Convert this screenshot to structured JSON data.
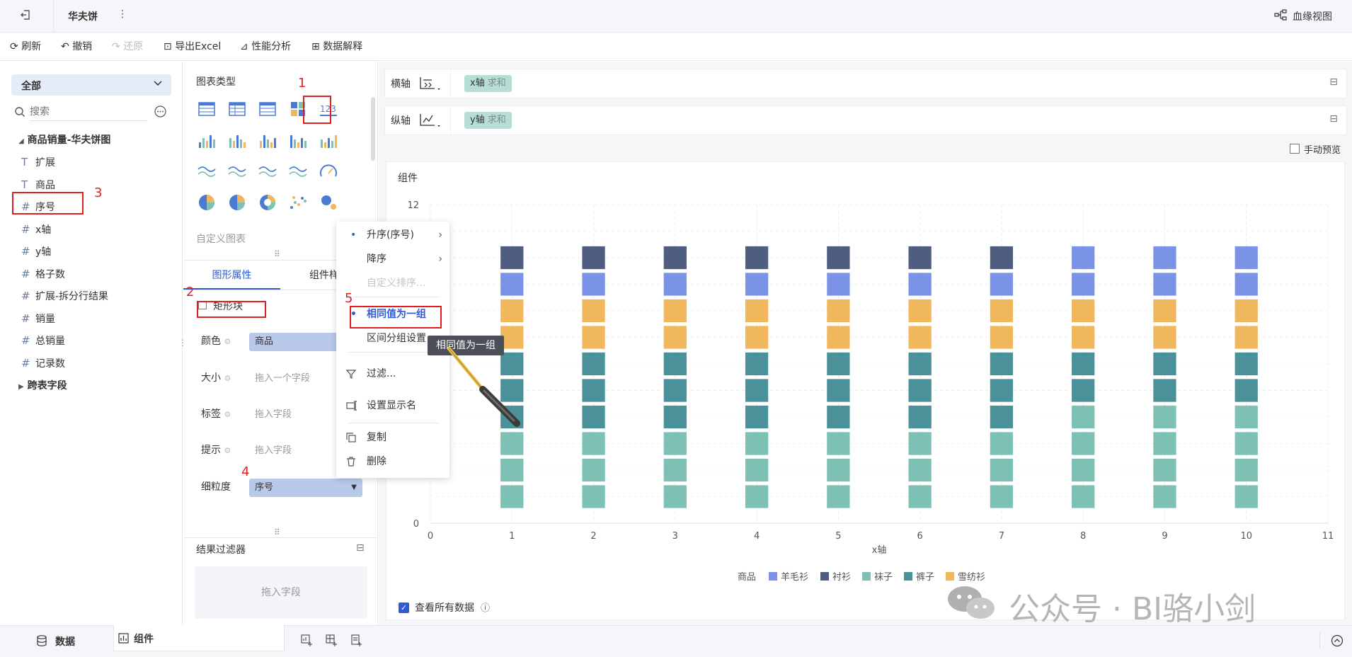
{
  "topbar": {
    "title": "华夫饼",
    "lineage": "血缘视图"
  },
  "toolbar": {
    "refresh": "刷新",
    "undo": "撤销",
    "redo": "还原",
    "export": "导出Excel",
    "perf": "性能分析",
    "explain": "数据解释"
  },
  "left": {
    "dropdown": "全部",
    "search_placeholder": "搜索",
    "table_name": "商品销量-华夫饼图",
    "fields": [
      {
        "type": "T",
        "name": "扩展"
      },
      {
        "type": "T",
        "name": "商品"
      },
      {
        "type": "#",
        "name": "序号"
      },
      {
        "type": "#",
        "name": "x轴"
      },
      {
        "type": "#",
        "name": "y轴"
      },
      {
        "type": "#",
        "name": "格子数"
      },
      {
        "type": "#",
        "name": "扩展-拆分行结果"
      },
      {
        "type": "#",
        "name": "销量"
      },
      {
        "type": "#",
        "name": "总销量"
      },
      {
        "type": "#",
        "name": "记录数"
      }
    ],
    "cross_table": "跨表字段"
  },
  "mid": {
    "chart_type_label": "图表类型",
    "custom_chart": "自定义图表",
    "tab_props": "图形属性",
    "tab_style": "组件样式",
    "shape": "矩形块",
    "color_label": "颜色",
    "color_value": "商品",
    "size_label": "大小",
    "size_placeholder": "拖入一个字段",
    "label_label": "标签",
    "label_placeholder": "拖入字段",
    "tip_label": "提示",
    "tip_placeholder": "拖入字段",
    "granularity_label": "细粒度",
    "granularity_value": "序号",
    "result_filter": "结果过滤器",
    "drop_field": "拖入字段"
  },
  "right": {
    "h_axis": "横轴",
    "v_axis": "纵轴",
    "h_pill": "x轴",
    "v_pill": "y轴",
    "agg": "求和",
    "manual_preview": "手动预览",
    "component": "组件",
    "view_all": "查看所有数据"
  },
  "menu": {
    "asc": "升序(序号)",
    "desc": "降序",
    "custom_sort": "自定义排序...",
    "same_group": "相同值为一组",
    "interval": "区间分组设置",
    "filter": "过滤...",
    "display_name": "设置显示名",
    "copy": "复制",
    "delete": "删除",
    "tooltip": "相同值为一组"
  },
  "annotations": [
    "1",
    "2",
    "3",
    "4",
    "5"
  ],
  "bottom": {
    "data_tab": "数据",
    "component_tab": "组件"
  },
  "watermark": "公众号 · BI骆小剑",
  "colors": {
    "羊毛衫": "#7b93e6",
    "衬衫": "#4e5d80",
    "袜子": "#7dc0b4",
    "裤子": "#4a9199",
    "雪纺衫": "#f0b75c",
    "accent": "#2f5ad8",
    "annotation": "#e02020"
  },
  "chart_data": {
    "type": "scatter",
    "marker": "square",
    "xlabel": "x轴",
    "ylabel": "",
    "xlim": [
      0,
      11
    ],
    "ylim": [
      0,
      12
    ],
    "x_ticks": [
      "0",
      "1",
      "2",
      "3",
      "4",
      "5",
      "6",
      "7",
      "8",
      "9",
      "10",
      "11"
    ],
    "y_ticks": [
      "0",
      "12"
    ],
    "legend_title": "商品",
    "legend_position": "bottom",
    "series": [
      {
        "name": "羊毛衫",
        "points": [
          [
            8,
            10
          ],
          [
            9,
            10
          ],
          [
            10,
            10
          ],
          [
            1,
            9
          ],
          [
            2,
            9
          ],
          [
            3,
            9
          ],
          [
            4,
            9
          ],
          [
            5,
            9
          ],
          [
            6,
            9
          ],
          [
            7,
            9
          ],
          [
            8,
            9
          ],
          [
            9,
            9
          ],
          [
            10,
            9
          ]
        ]
      },
      {
        "name": "衬衫",
        "points": [
          [
            1,
            10
          ],
          [
            2,
            10
          ],
          [
            3,
            10
          ],
          [
            4,
            10
          ],
          [
            5,
            10
          ],
          [
            6,
            10
          ],
          [
            7,
            10
          ]
        ]
      },
      {
        "name": "袜子",
        "points": [
          [
            8,
            4
          ],
          [
            9,
            4
          ],
          [
            10,
            4
          ],
          [
            1,
            3
          ],
          [
            2,
            3
          ],
          [
            3,
            3
          ],
          [
            4,
            3
          ],
          [
            5,
            3
          ],
          [
            6,
            3
          ],
          [
            7,
            3
          ],
          [
            8,
            3
          ],
          [
            9,
            3
          ],
          [
            10,
            3
          ],
          [
            1,
            2
          ],
          [
            2,
            2
          ],
          [
            3,
            2
          ],
          [
            4,
            2
          ],
          [
            5,
            2
          ],
          [
            6,
            2
          ],
          [
            7,
            2
          ],
          [
            8,
            2
          ],
          [
            9,
            2
          ],
          [
            10,
            2
          ],
          [
            1,
            1
          ],
          [
            2,
            1
          ],
          [
            3,
            1
          ],
          [
            4,
            1
          ],
          [
            5,
            1
          ],
          [
            6,
            1
          ],
          [
            7,
            1
          ],
          [
            8,
            1
          ],
          [
            9,
            1
          ],
          [
            10,
            1
          ]
        ]
      },
      {
        "name": "裤子",
        "points": [
          [
            1,
            6
          ],
          [
            2,
            6
          ],
          [
            3,
            6
          ],
          [
            4,
            6
          ],
          [
            5,
            6
          ],
          [
            6,
            6
          ],
          [
            7,
            6
          ],
          [
            8,
            6
          ],
          [
            9,
            6
          ],
          [
            10,
            6
          ],
          [
            1,
            5
          ],
          [
            2,
            5
          ],
          [
            3,
            5
          ],
          [
            4,
            5
          ],
          [
            5,
            5
          ],
          [
            6,
            5
          ],
          [
            7,
            5
          ],
          [
            8,
            5
          ],
          [
            9,
            5
          ],
          [
            10,
            5
          ],
          [
            1,
            4
          ],
          [
            2,
            4
          ],
          [
            3,
            4
          ],
          [
            4,
            4
          ],
          [
            5,
            4
          ],
          [
            6,
            4
          ],
          [
            7,
            4
          ]
        ]
      },
      {
        "name": "雪纺衫",
        "points": [
          [
            1,
            8
          ],
          [
            2,
            8
          ],
          [
            3,
            8
          ],
          [
            4,
            8
          ],
          [
            5,
            8
          ],
          [
            6,
            8
          ],
          [
            7,
            8
          ],
          [
            8,
            8
          ],
          [
            9,
            8
          ],
          [
            10,
            8
          ],
          [
            1,
            7
          ],
          [
            2,
            7
          ],
          [
            3,
            7
          ],
          [
            4,
            7
          ],
          [
            5,
            7
          ],
          [
            6,
            7
          ],
          [
            7,
            7
          ],
          [
            8,
            7
          ],
          [
            9,
            7
          ],
          [
            10,
            7
          ]
        ]
      }
    ]
  }
}
